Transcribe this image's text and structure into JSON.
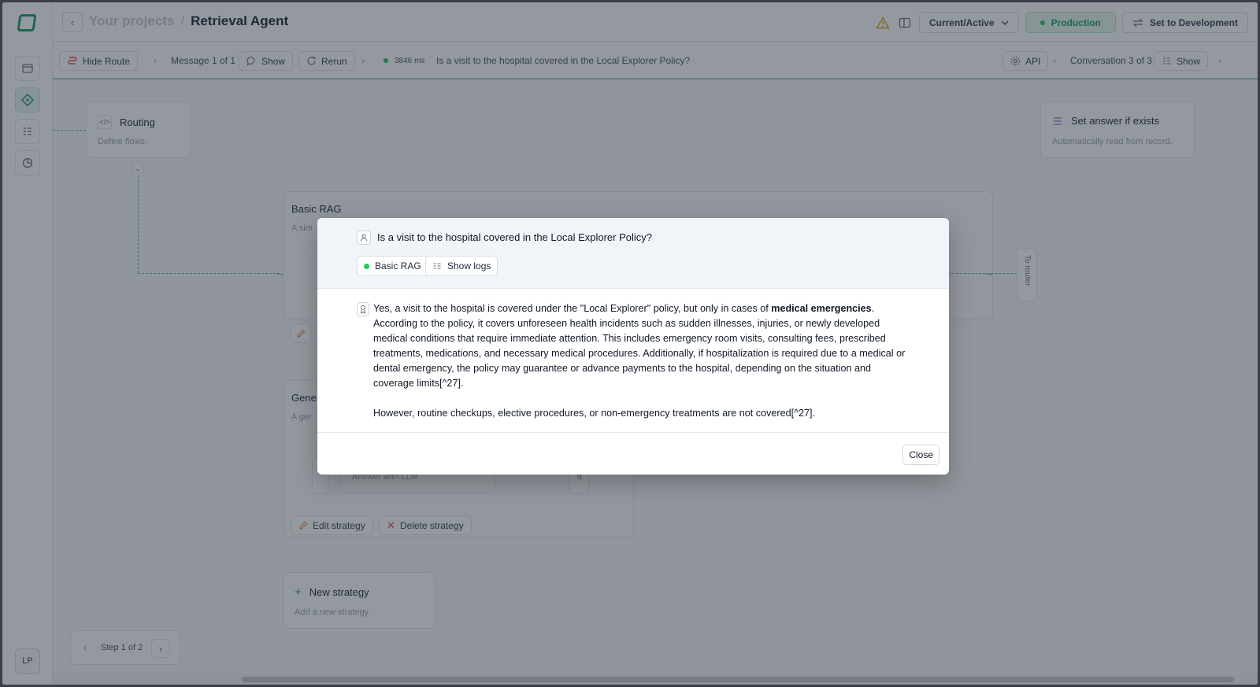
{
  "header": {
    "breadcrumb_root": "Your projects",
    "separator": "/",
    "title": "Retrieval Agent",
    "version_select": "Current/Active",
    "production_label": "Production",
    "set_dev_label": "Set to Development"
  },
  "toolbar": {
    "hide_route": "Hide Route",
    "message_counter": "Message 1 of 1",
    "show": "Show",
    "rerun": "Rerun",
    "latency": "3846 ms",
    "query": "Is a visit to the hospital covered in the Local Explorer Policy?",
    "api": "API",
    "conversation_counter": "Conversation 3 of 3",
    "show_right": "Show"
  },
  "sidebar": {
    "avatar_initials": "LP"
  },
  "canvas": {
    "routing": {
      "title": "Routing",
      "subtitle": "Define flows."
    },
    "set_answer": {
      "title": "Set answer if exists",
      "subtitle": "Automatically read from record."
    },
    "basic_rag": {
      "title": "Basic RAG",
      "subtitle": "A sim"
    },
    "general": {
      "title": "Gene",
      "subtitle": "A ger"
    },
    "answer_llm": "Answer with LLM",
    "to_router": "To router",
    "to_router_partial": "outer",
    "edit_strategy": "Edit strategy",
    "delete_strategy": "Delete strategy",
    "new_strategy": {
      "title": "New strategy",
      "subtitle": "Add a new strategy"
    },
    "step_counter": "Step 1 of 2"
  },
  "modal": {
    "question": "Is a visit to the hospital covered in the Local Explorer Policy?",
    "chip_strategy": "Basic RAG",
    "chip_logs": "Show logs",
    "answer_p1_pre": "Yes, a visit to the hospital is covered under the \"Local Explorer\" policy, but only in cases of ",
    "answer_p1_bold": "medical emergencies",
    "answer_p1_post": ". According to the policy, it covers unforeseen health incidents such as sudden illnesses, injuries, or newly developed medical conditions that require immediate attention. This includes emergency room visits, consulting fees, prescribed treatments, medications, and necessary medical procedures. Additionally, if hospitalization is required due to a medical or dental emergency, the policy may guarantee or advance payments to the hospital, depending on the situation and coverage limits[^27].",
    "answer_p2": "However, routine checkups, elective procedures, or non-emergency treatments are not covered[^27].",
    "close": "Close"
  },
  "colors": {
    "accent": "#1e9c6c",
    "status_dot": "#22c55e",
    "route_line": "#5fb0a0",
    "danger": "#e5484d"
  }
}
